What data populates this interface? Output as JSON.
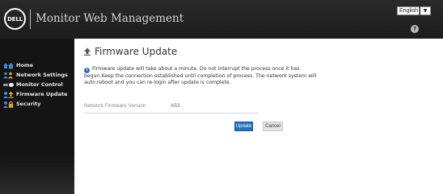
{
  "header": {
    "logo_text": "DELL",
    "app_title": "Monitor Web Management",
    "language": {
      "selected": "English"
    },
    "help_icon": "question-mark-icon"
  },
  "sidebar": {
    "items": [
      {
        "label": "Home",
        "icon": "home-icon"
      },
      {
        "label": "Network Settings",
        "icon": "network-users-icon"
      },
      {
        "label": "Monitor Control",
        "icon": "monitor-control-icon"
      },
      {
        "label": "Firmware Update",
        "icon": "upload-icon",
        "active": true
      },
      {
        "label": "Security",
        "icon": "lock-icon"
      }
    ]
  },
  "main": {
    "title": "Firmware Update",
    "notice": "Firmware update will take about a minute. Do not interrupt the process once it has begun.Keep the connection established until completion of process. The network system will auto reboot and you can re-login after update is complete.",
    "firmware_label": "Network Firmware Version",
    "firmware_value": "A53",
    "update_label": "Update",
    "cancel_label": "Cancel"
  },
  "colors": {
    "header_bg": "#1c1c1c",
    "sidebar_bg": "#141414",
    "accent_blue": "#1e73be",
    "icon_blue": "#3d8ad6",
    "icon_gold": "#e0a23a"
  }
}
